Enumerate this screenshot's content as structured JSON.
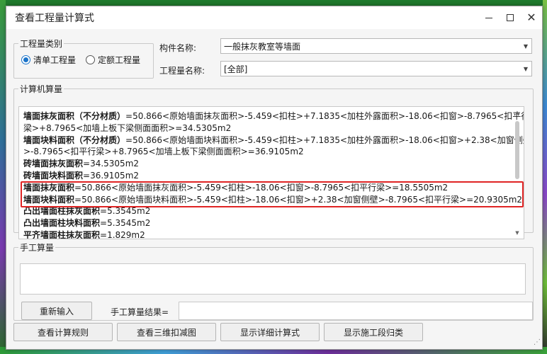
{
  "window": {
    "title": "查看工程量计算式"
  },
  "quantity_type": {
    "legend": "工程量类别",
    "options": [
      {
        "label": "清单工程量",
        "checked": true
      },
      {
        "label": "定额工程量",
        "checked": false
      }
    ]
  },
  "component": {
    "label": "构件名称:",
    "value": "一般抹灰教室等墙面"
  },
  "quantity_name": {
    "label": "工程量名称:",
    "value": "[全部]"
  },
  "computer_calc": {
    "legend": "计算机算量",
    "lines": [
      {
        "label": "墙面抹灰面积（不分材质）",
        "text": "=50.866<原始墙面抹灰面积>-5.459<扣柱>+7.1835<加柱外露面积>-18.06<扣窗>-8.7965<扣平行"
      },
      {
        "label": "",
        "text": "梁>+8.7965<加墙上板下梁侧面面积>=34.5305m2"
      },
      {
        "label": "墙面块料面积（不分材质）",
        "text": "=50.866<原始墙面块料面积>-5.459<扣柱>+7.1835<加柱外露面积>-18.06<扣窗>+2.38<加窗侧壁"
      },
      {
        "label": "",
        "text": ">-8.7965<扣平行梁>+8.7965<加墙上板下梁侧面面积>=36.9105m2"
      },
      {
        "label": "砖墙面抹灰面积",
        "text": "=34.5305m2"
      },
      {
        "label": "砖墙面块料面积",
        "text": "=36.9105m2"
      },
      {
        "label": "墙面抹灰面积",
        "text": "=50.866<原始墙面抹灰面积>-5.459<扣柱>-18.06<扣窗>-8.7965<扣平行梁>=18.5505m2"
      },
      {
        "label": "墙面块料面积",
        "text": "=50.866<原始墙面块料面积>-5.459<扣柱>-18.06<扣窗>+2.38<加窗侧壁>-8.7965<扣平行梁>=20.9305m2"
      },
      {
        "label": "凸出墙面柱抹灰面积",
        "text": "=5.3545m2"
      },
      {
        "label": "凸出墙面柱块料面积",
        "text": "=5.3545m2"
      },
      {
        "label": "平齐墙面柱抹灰面积",
        "text": "=1.829m2"
      }
    ]
  },
  "manual_calc": {
    "legend": "手工算量",
    "reenter_label": "重新输入",
    "result_label": "手工算量结果="
  },
  "footer": {
    "rules_label": "查看计算规则",
    "view3d_label": "查看三维扣减图",
    "detail_label": "显示详细计算式",
    "segment_label": "显示施工段归类"
  },
  "colors": {
    "highlight": "#e02424",
    "radio_accent": "#1a73c9"
  }
}
